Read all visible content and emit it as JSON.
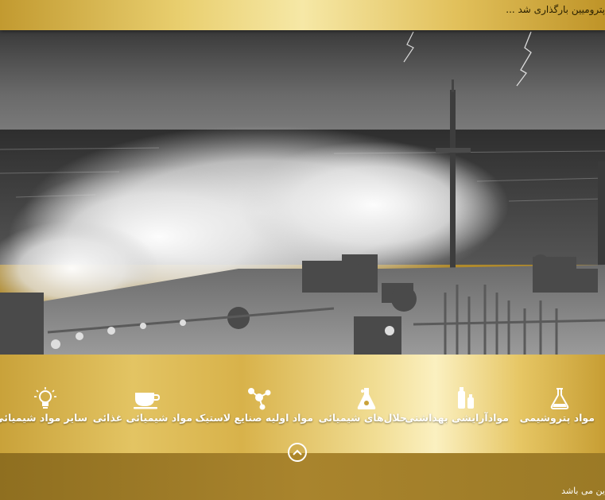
{
  "ticker": {
    "text": "پترومیین بارگذاری شد ..."
  },
  "hero": {
    "image": "tanker-ship-storm-waves"
  },
  "categories": [
    {
      "label": "مواد پتروشیمی",
      "icon": "flask-icon"
    },
    {
      "label": "موادآرایشی بهداشتی",
      "icon": "cosmetics-icon"
    },
    {
      "label": "حلال‌های شیمیائی",
      "icon": "beaker-icon"
    },
    {
      "label": "مواد اولیه صنایع لاستیک",
      "icon": "molecule-icon"
    },
    {
      "label": "مواد شیمیائی غذائی",
      "icon": "cup-icon"
    },
    {
      "label": "سایر مواد شیمیائی",
      "icon": "lightbulb-icon"
    }
  ],
  "scroll_top": {
    "icon": "chevron-up-icon"
  },
  "footer": {
    "text": "ین می باشد"
  },
  "colors": {
    "gold": "#d4af47",
    "gold_light": "#f6e8a6",
    "footer": "#a07e28",
    "text_light": "#ffffff"
  }
}
